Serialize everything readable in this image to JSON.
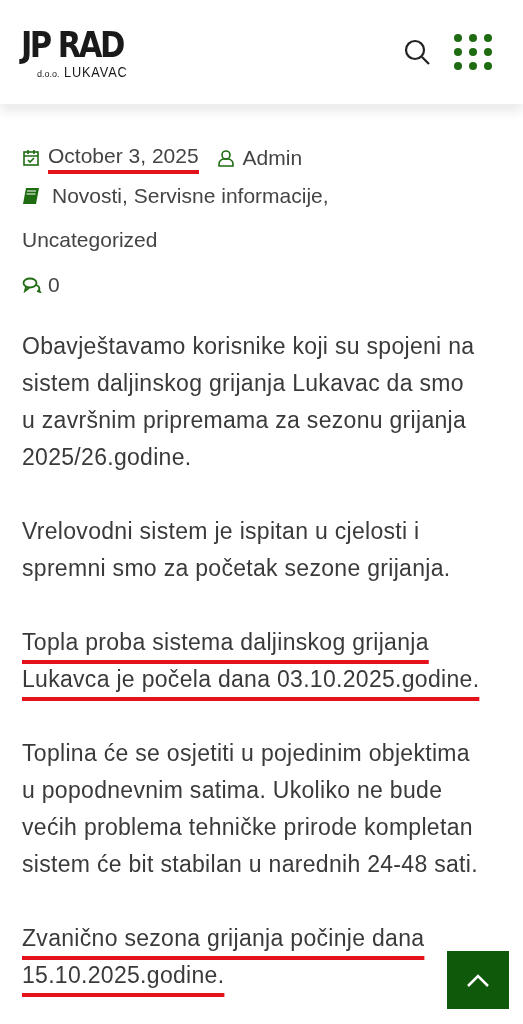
{
  "logo": {
    "main": "JP RAD",
    "suffix": "d.o.o.",
    "town": "LUKAVAC"
  },
  "meta": {
    "date": {
      "text": "October 3, 2025",
      "underlined": true
    },
    "author": "Admin",
    "categories": [
      "Novosti, Servisne informacije,",
      "Uncategorized"
    ],
    "comments": "0"
  },
  "paragraphs": [
    {
      "lines": [
        "Obavještavamo korisnike koji su spojeni na",
        "sistem daljinskog grijanja Lukavac da smo",
        "u završnim pripremama za sezonu grijanja",
        "2025/26.godine."
      ],
      "underlined": false
    },
    {
      "lines": [
        "Vrelovodni sistem je ispitan u cjelosti i",
        "spremni smo za početak sezone grijanja."
      ],
      "underlined": false
    },
    {
      "lines": [
        "Topla proba sistema daljinskog grijanja",
        "Lukavca je počela dana 03.10.2025.godine."
      ],
      "underlined": true
    },
    {
      "lines": [
        "Toplina će se osjetiti u pojedinim objektima",
        "u popodnevnim satima. Ukoliko ne bude",
        "većih problema tehničke prirode kompletan",
        "sistem će bit stabilan u narednih 24-48 sati."
      ],
      "underlined": false
    },
    {
      "lines": [
        "Zvanično sezona grijanja počinje dana",
        "15.10.2025.godine."
      ],
      "underlined": true
    }
  ]
}
